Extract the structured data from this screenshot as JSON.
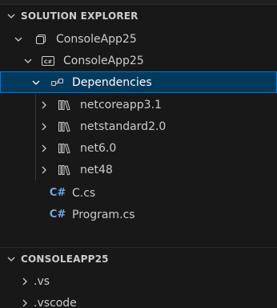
{
  "solution_explorer": {
    "header": "SOLUTION EXPLORER",
    "items": [
      {
        "label": "ConsoleApp25",
        "icon": "solution-icon",
        "expanded": true
      },
      {
        "label": "ConsoleApp25",
        "icon": "csharp-project-icon",
        "expanded": true
      },
      {
        "label": "Dependencies",
        "icon": "dependencies-icon",
        "expanded": true,
        "selected": true
      },
      {
        "label": "netcoreapp3.1",
        "icon": "framework-library-icon",
        "expanded": false
      },
      {
        "label": "netstandard2.0",
        "icon": "framework-library-icon",
        "expanded": false
      },
      {
        "label": "net6.0",
        "icon": "framework-library-icon",
        "expanded": false
      },
      {
        "label": "net48",
        "icon": "framework-library-icon",
        "expanded": false
      },
      {
        "label": "C.cs",
        "icon": "csharp-file-icon"
      },
      {
        "label": "Program.cs",
        "icon": "csharp-file-icon"
      }
    ]
  },
  "explorer": {
    "header": "CONSOLEAPP25",
    "items": [
      {
        "label": ".vs",
        "icon": "folder",
        "expanded": false
      },
      {
        "label": ".vscode",
        "icon": "folder",
        "expanded": false
      }
    ]
  },
  "colors": {
    "background": "#181818",
    "selection": "#04395e",
    "selection_border": "#0078d4",
    "csharp_icon": "#6fa8e6"
  }
}
